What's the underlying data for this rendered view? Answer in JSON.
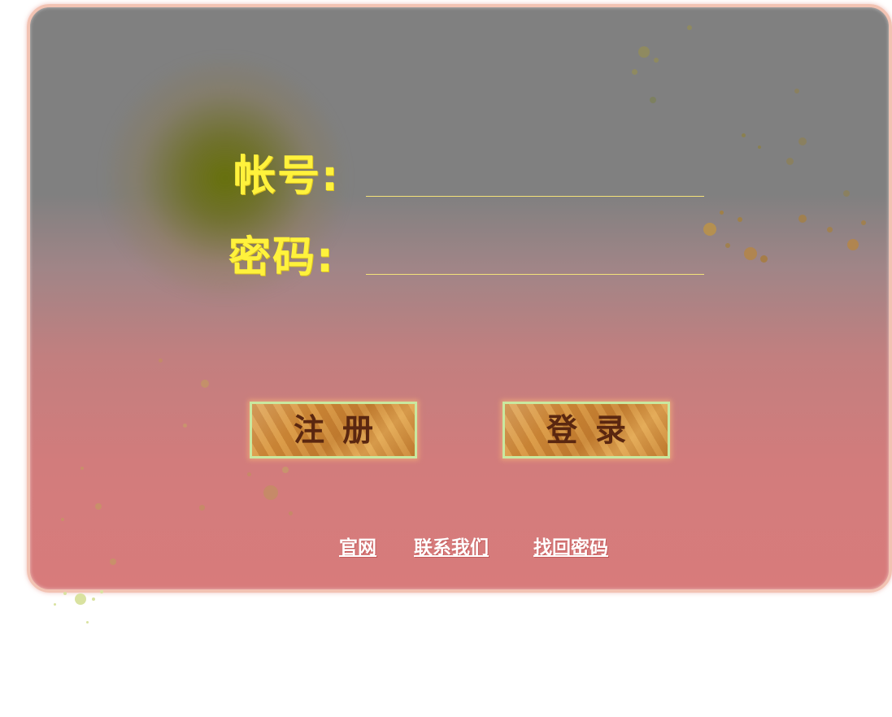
{
  "form": {
    "account_label": "帐号:",
    "account_value": "",
    "password_label": "密码:",
    "password_value": ""
  },
  "buttons": {
    "register": "注册",
    "login": "登录"
  },
  "links": {
    "official_site": "官网",
    "contact_us": "联系我们",
    "recover_password": "找回密码"
  },
  "colors": {
    "label": "#fff23c",
    "panel_top": "#808080",
    "panel_bottom": "#d87b7b",
    "button_text": "#5a2710",
    "link": "#ffffff"
  }
}
